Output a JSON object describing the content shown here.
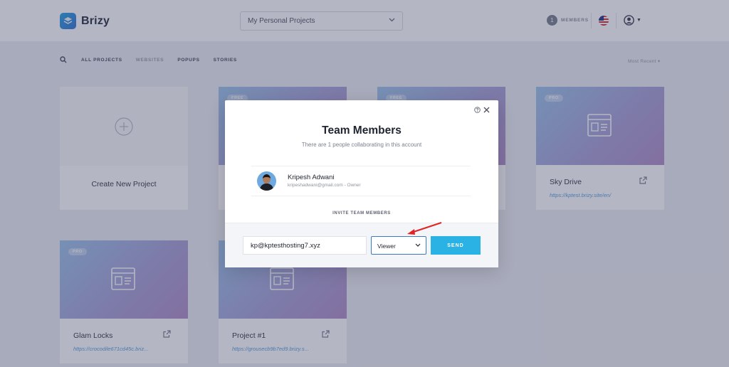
{
  "header": {
    "brand": "Brizy",
    "project_select": "My Personal Projects",
    "members_count": "1",
    "members_label": "MEMBERS"
  },
  "filters": {
    "tabs": [
      "ALL PROJECTS",
      "WEBSITES",
      "POPUPS",
      "STORIES"
    ],
    "active_tab": "WEBSITES",
    "sort": "Most Recent ▾"
  },
  "cards": {
    "create_label": "Create New Project",
    "items": [
      {
        "badge": "FREE",
        "name": "",
        "url": ""
      },
      {
        "badge": "FREE",
        "name": "",
        "url": ""
      },
      {
        "badge": "PRO",
        "name": "Sky Drive",
        "url": "https://kptest.brizy.site/en/"
      },
      {
        "badge": "PRO",
        "name": "Glam Locks",
        "url": "https://crocodile671cd45c.briz..."
      },
      {
        "badge": "",
        "name": "Project #1",
        "url": "https://grousecb9b7ed9.brizy.s..."
      }
    ]
  },
  "modal": {
    "title": "Team Members",
    "subtitle": "There are 1 people collaborating in this account",
    "member": {
      "name": "Kripesh Adwani",
      "meta": "kripeshadwani@gmail.com - Owner"
    },
    "invite_label": "INVITE TEAM MEMBERS",
    "email_value": "kp@kptesthosting7.xyz",
    "role_value": "Viewer",
    "send_label": "SEND"
  },
  "colors": {
    "accent": "#29b2e3",
    "overlay": "#2c2f52",
    "arrow": "#e02424"
  },
  "icons": [
    "search-icon",
    "chevron-down-icon",
    "plus-icon",
    "layout-icon",
    "external-link-icon",
    "help-icon",
    "close-icon",
    "user-icon",
    "flag-icon"
  ]
}
